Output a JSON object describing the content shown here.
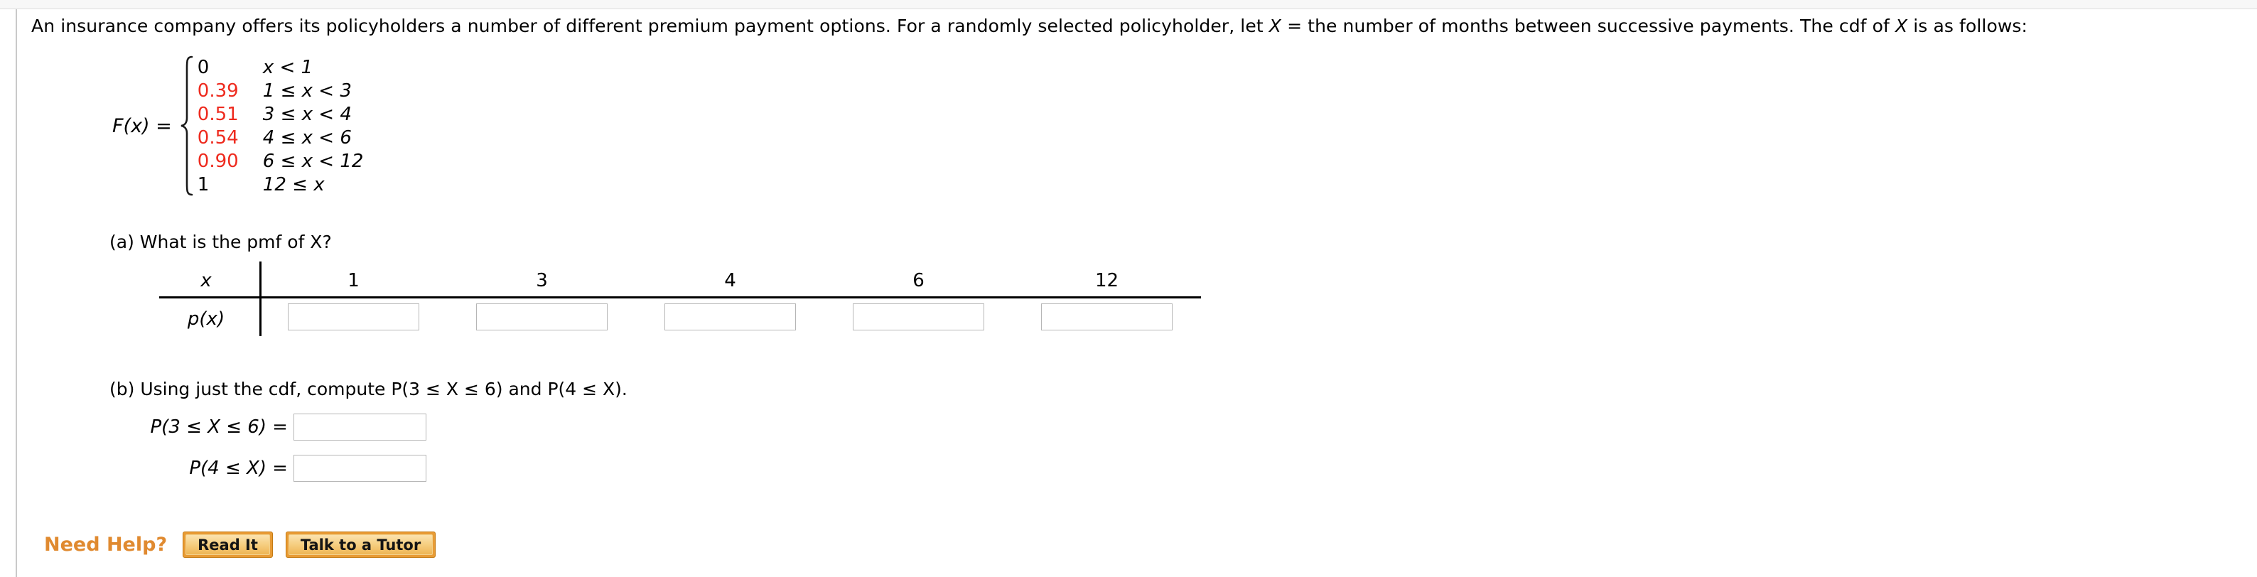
{
  "prompt": {
    "part1": "An insurance company offers its policyholders a number of different premium payment options. For a randomly selected policyholder, let ",
    "var1": "X",
    "part2": " = the number of months between successive payments. The cdf of ",
    "var2": "X",
    "part3": " is as follows:"
  },
  "cdf": {
    "label_fn": "F(x)",
    "label_eq": " = ",
    "rows": [
      {
        "value": "0",
        "condition": "x < 1",
        "red": false
      },
      {
        "value": "0.39",
        "condition": "1 ≤ x < 3",
        "red": true
      },
      {
        "value": "0.51",
        "condition": "3 ≤ x < 4",
        "red": true
      },
      {
        "value": "0.54",
        "condition": "4 ≤ x < 6",
        "red": true
      },
      {
        "value": "0.90",
        "condition": "6 ≤ x < 12",
        "red": true
      },
      {
        "value": "1",
        "condition": "12 ≤ x",
        "red": false
      }
    ],
    "red_color": "#ee2a1e"
  },
  "part_a": {
    "question": "(a) What is the pmf of X?",
    "table": {
      "row_label_x": "x",
      "row_label_px": "p(x)",
      "x_values": [
        "1",
        "3",
        "4",
        "6",
        "12"
      ],
      "p_values": [
        "",
        "",
        "",
        "",
        ""
      ],
      "p_placeholder": ""
    }
  },
  "part_b": {
    "question": "(b) Using just the cdf, compute P(3 ≤ X ≤ 6) and P(4 ≤ X).",
    "rows": [
      {
        "label": "P(3 ≤ X ≤ 6)",
        "equals": "=",
        "value": "",
        "placeholder": ""
      },
      {
        "label": "P(4 ≤ X)",
        "equals": "=",
        "value": "",
        "placeholder": ""
      }
    ]
  },
  "need_help": {
    "label": "Need Help?",
    "label_color": "#e08a30",
    "buttons": [
      {
        "text": "Read It"
      },
      {
        "text": "Talk to a Tutor"
      }
    ]
  }
}
